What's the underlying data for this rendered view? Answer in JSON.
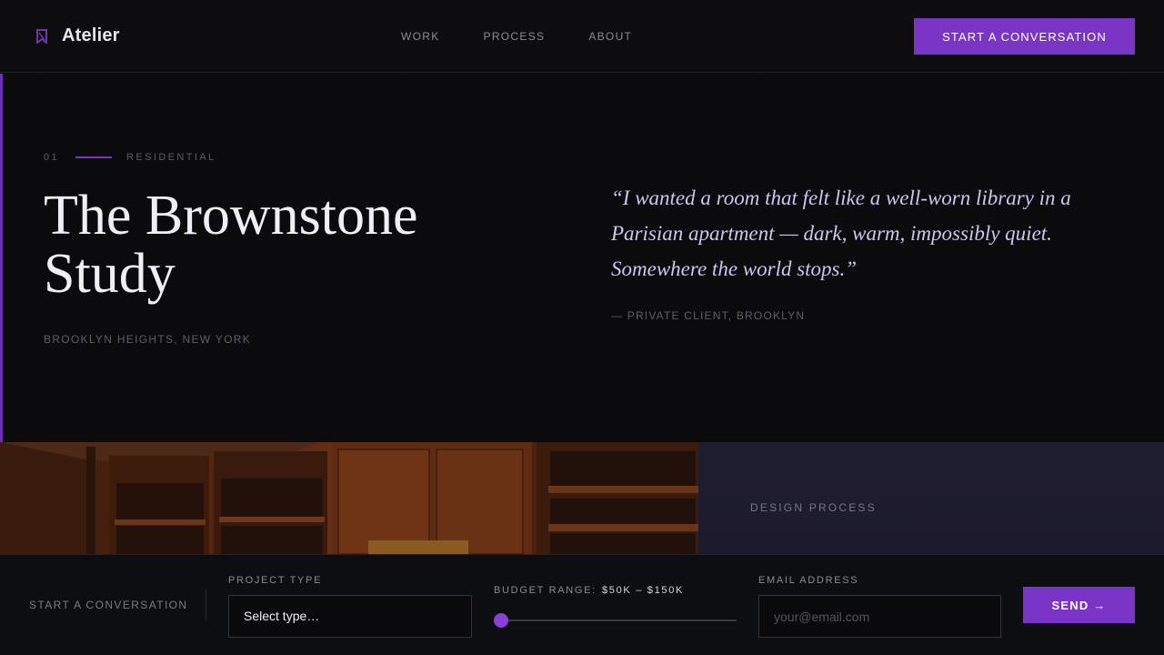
{
  "brand": {
    "name": "Atelier",
    "logo_icon": "bookmark-logo-icon",
    "accent_color": "#7b35c6"
  },
  "nav": {
    "items": [
      {
        "label": "WORK"
      },
      {
        "label": "PROCESS"
      },
      {
        "label": "ABOUT"
      }
    ]
  },
  "header": {
    "cta_label": "START A CONVERSATION"
  },
  "hero": {
    "index": "01",
    "category": "RESIDENTIAL",
    "title": "The Brownstone Study",
    "location": "BROOKLYN HEIGHTS, NEW YORK",
    "quote": "“I wanted a room that felt like a well-worn library in a Parisian apartment — dark, warm, impossibly quiet. Somewhere the world stops.”",
    "attribution": "— PRIVATE CLIENT, BROOKLYN"
  },
  "strip": {
    "label": "DESIGN PROCESS"
  },
  "form": {
    "section_label": "START A CONVERSATION",
    "project_type": {
      "label": "PROJECT TYPE",
      "value": "Select type…"
    },
    "budget": {
      "label": "BUDGET RANGE:",
      "value": "$50K – $150K",
      "slider_level": 0
    },
    "email": {
      "label": "EMAIL ADDRESS",
      "placeholder": "your@email.com"
    },
    "submit_label": "SEND →"
  }
}
